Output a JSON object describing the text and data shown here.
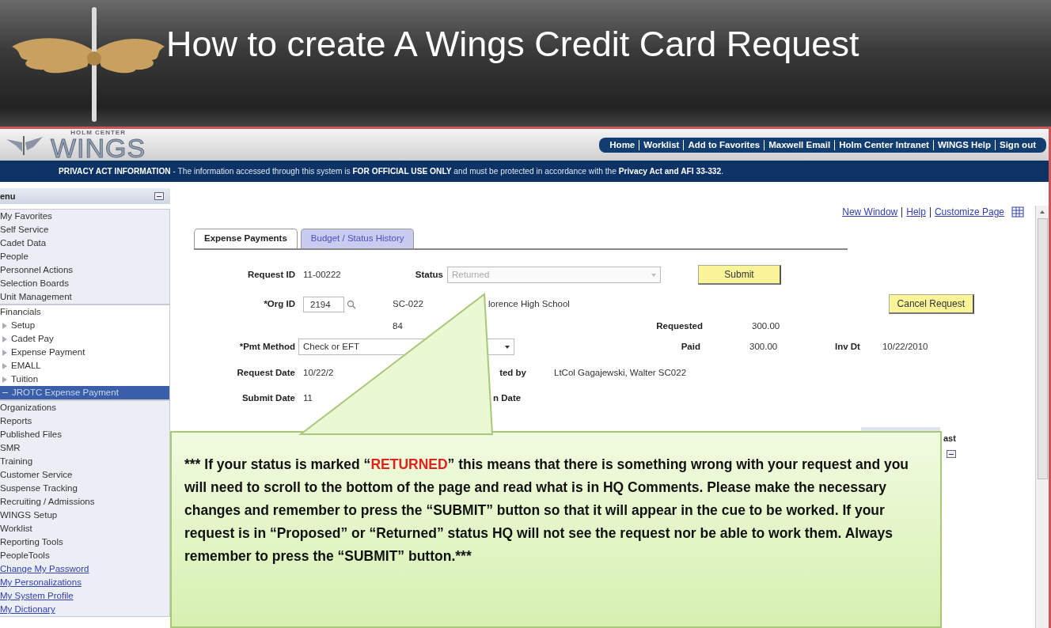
{
  "slide": {
    "title": "How to create A Wings Credit Card Request"
  },
  "app": {
    "logo": {
      "tagline": "HOLM CENTER",
      "name": "WINGS"
    },
    "nav_links": [
      "Home",
      "Worklist",
      "Add to Favorites",
      "Maxwell Email",
      "Holm Center Intranet",
      "WINGS Help",
      "Sign out"
    ],
    "privacy_notice": "**PRIVACY ACT INFORMATION** - The information accessed through this system is **FOR OFFICIAL USE ONLY** and must be protected in accordance with the **Privacy Act and AFI 33-332**.",
    "sidebar": {
      "title": "enu",
      "groups": [
        {
          "items": [
            {
              "label": "My Favorites",
              "kind": "folder",
              "selected": false
            },
            {
              "label": "Self Service",
              "kind": "folder",
              "selected": false
            },
            {
              "label": "Cadet Data",
              "kind": "folder",
              "selected": false
            },
            {
              "label": "People",
              "kind": "folder",
              "selected": false
            },
            {
              "label": "Personnel Actions",
              "kind": "folder",
              "selected": false
            },
            {
              "label": "Selection Boards",
              "kind": "folder",
              "selected": false
            },
            {
              "label": "Unit Management",
              "kind": "folder",
              "selected": false
            }
          ]
        },
        {
          "items": [
            {
              "label": "Financials",
              "kind": "folder",
              "selected": false,
              "expanded": true,
              "children": [
                {
                  "label": "Setup",
                  "expanded": false,
                  "selected": false
                },
                {
                  "label": "Cadet Pay",
                  "expanded": false,
                  "selected": false
                },
                {
                  "label": "Expense Payment",
                  "expanded": false,
                  "selected": false
                },
                {
                  "label": "EMALL",
                  "expanded": false,
                  "selected": false
                },
                {
                  "label": "Tuition",
                  "expanded": false,
                  "selected": false
                },
                {
                  "label": "JROTC Expense Payment",
                  "expanded": true,
                  "selected": true
                }
              ]
            }
          ]
        },
        {
          "items": [
            {
              "label": "Organizations",
              "kind": "folder",
              "selected": false
            },
            {
              "label": "Reports",
              "kind": "folder",
              "selected": false
            },
            {
              "label": "Published Files",
              "kind": "folder",
              "selected": false
            },
            {
              "label": "SMR",
              "kind": "folder",
              "selected": false
            },
            {
              "label": "Training",
              "kind": "folder",
              "selected": false
            },
            {
              "label": "Customer Service",
              "kind": "folder",
              "selected": false
            },
            {
              "label": "Suspense Tracking",
              "kind": "folder",
              "selected": false
            },
            {
              "label": "Recruiting / Admissions",
              "kind": "folder",
              "selected": false
            },
            {
              "label": "WINGS Setup",
              "kind": "folder",
              "selected": false
            },
            {
              "label": "Worklist",
              "kind": "folder",
              "selected": false
            },
            {
              "label": "Reporting Tools",
              "kind": "folder",
              "selected": false
            },
            {
              "label": "PeopleTools",
              "kind": "folder",
              "selected": false
            },
            {
              "label": "Change My Password",
              "kind": "link",
              "selected": false
            },
            {
              "label": "My Personalizations",
              "kind": "link",
              "selected": false
            },
            {
              "label": "My System Profile",
              "kind": "link",
              "selected": false
            },
            {
              "label": "My Dictionary",
              "kind": "link",
              "selected": false
            }
          ]
        }
      ]
    },
    "page_links": [
      "New Window",
      "Help",
      "Customize Page"
    ],
    "tabs": [
      {
        "label": "Expense Payments",
        "selected": true
      },
      {
        "label": "Budget / Status History",
        "selected": false
      }
    ],
    "form": {
      "request_id": {
        "label": "Request ID",
        "value": "11-00222"
      },
      "status": {
        "label": "Status",
        "value": "Returned",
        "disabled": true
      },
      "submit_button": "Submit",
      "org_id": {
        "label": "*Org ID",
        "value": "2194"
      },
      "org_code": "SC-022",
      "org_name": "lorence High School",
      "org_number": "84",
      "cancel_button": "Cancel Request",
      "requested": {
        "label": "Requested",
        "value": "300.00"
      },
      "pmt_method": {
        "label": "*Pmt Method",
        "value": "Check or EFT"
      },
      "paid": {
        "label": "Paid",
        "value": "300.00"
      },
      "inv_dt": {
        "label": "Inv Dt",
        "value": "10/22/2010"
      },
      "request_date": {
        "label": "Request Date",
        "value": "10/22/2"
      },
      "requested_by": {
        "label": "ted by",
        "value": "LtCol Gagajewski, Walter SC022"
      },
      "submit_date": {
        "label": "Submit Date",
        "value": "11"
      },
      "date_field": {
        "label": "n Date"
      }
    },
    "grid_header": "ast"
  },
  "callout": {
    "parts": [
      {
        "text": "*** If your status is marked “",
        "highlight": false
      },
      {
        "text": "RETURNED",
        "highlight": true
      },
      {
        "text": "” this means that there is something wrong with your request and you will need to scroll to the bottom of the page and read what is in HQ Comments. Please make the necessary changes and remember to press the “SUBMIT” button so that it will appear in the cue to be worked. If your request is in “Proposed” or “Returned” status HQ will not see the request nor be able to work them. Always remember to press the “SUBMIT” button.***",
        "highlight": false
      }
    ]
  }
}
